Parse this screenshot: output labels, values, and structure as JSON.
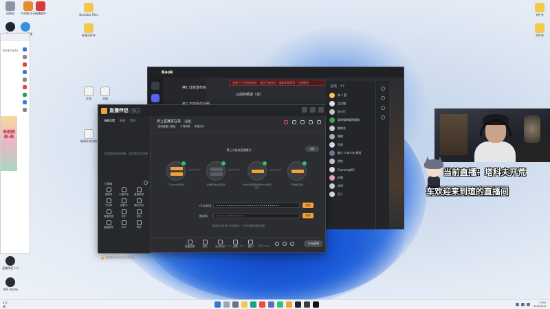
{
  "desktop": {
    "left_icons": [
      {
        "label": "回收站",
        "color": "#8a96a8"
      },
      {
        "label": "中文版-乐乐",
        "color": "#e98a2c"
      },
      {
        "label": "直播软件",
        "color": "#d93a3a"
      },
      {
        "label": "Steam",
        "color": "#1b2838"
      },
      {
        "label": "游戏加速器",
        "color": "#3a8ee0"
      }
    ],
    "folder_icons": [
      {
        "label": "Bandizip Files",
        "color": "#f2c94c"
      },
      {
        "label": "新建文件夹",
        "color": "#f2c94c"
      }
    ],
    "right_icons": [
      {
        "label": "文件夹",
        "color": "#f2c94c"
      },
      {
        "label": "文件夹",
        "color": "#f2c94c"
      }
    ],
    "bottom_icons": [
      {
        "label": "直播伴侣 1.0",
        "color": "#2a2d33"
      },
      {
        "label": "OBS Studio",
        "color": "#2a2d33"
      }
    ],
    "doc_icons": [
      {
        "label": "文档",
        "color": "#e8e8e8"
      },
      {
        "label": "文档",
        "color": "#e8e8e8"
      },
      {
        "label": "新建文本文档",
        "color": "#e8e8e8"
      }
    ]
  },
  "browser": {
    "tab_label": "Bookmarks",
    "banner_text": "来刷刷 画·画"
  },
  "chat_app": {
    "brand": "Kook",
    "room_title": "神1 日前发布完",
    "channel_title": "以前的频道（全）",
    "channel2": "第三方的事件问题",
    "alert": "频道个人消息被锁定 · 成员已被禁言 · 请联系管理员",
    "alert_btn": "立即解锁",
    "members_head": "在线 · 37",
    "members": [
      {
        "name": "神 1 狐",
        "color": "#f3c64a"
      },
      {
        "name": "吉吉猫",
        "color": "#e0e4ea"
      },
      {
        "name": "奶小叮",
        "color": "#c9c9c9"
      },
      {
        "name": "猫咪猫咪猫咪猫咪",
        "color": "#3fa45a"
      },
      {
        "name": "糖果花",
        "color": "#d0d4da"
      },
      {
        "name": "棉棉",
        "color": "#a7b2c0"
      },
      {
        "name": "豆皮",
        "color": "#dfe3e8"
      },
      {
        "name": "敏小 少年少年 想说",
        "color": "#6a7d94"
      },
      {
        "name": "快快",
        "color": "#c5cbd2"
      },
      {
        "name": "FlameingHD",
        "color": "#e5e5e5"
      },
      {
        "name": "好猫",
        "color": "#f0a7b4"
      },
      {
        "name": "炸鸡",
        "color": "#cdd2d9"
      },
      {
        "name": "无人",
        "color": "#d8dce2"
      }
    ]
  },
  "app": {
    "brand": "直播伴侣",
    "version": "PC ▾",
    "sidebar_tabs": [
      "场景设置",
      "直播",
      "素材"
    ],
    "empty_tip": "添加素材开始直播，添加素材至场景",
    "tools_label": "工具箱",
    "tools": [
      {
        "label": "直播间"
      },
      {
        "label": "主播学堂"
      },
      {
        "label": "直播数据"
      },
      {
        "label": "节目单"
      },
      {
        "label": "连麦PK"
      },
      {
        "label": "福利派送"
      },
      {
        "label": "直播设置"
      },
      {
        "label": "音乐"
      },
      {
        "label": "更多"
      },
      {
        "label": "直播推荐"
      },
      {
        "label": "OBS"
      },
      {
        "label": "帮助"
      }
    ],
    "hint": "观看直播间请关注主播直播",
    "room_name": "去上直播发在等",
    "room_tag": "直播",
    "sub_items": [
      "游戏直播 · 电脑",
      "开播提醒",
      "直播回放"
    ],
    "step_header": "第三方推流直播模式",
    "switch_btn": "切换",
    "steps": [
      {
        "label": "下载OBS推流软件"
      },
      {
        "label": "复制推流地址和密钥"
      },
      {
        "label": "将地址和密钥粘贴到OBS推流设置中"
      },
      {
        "label": "开始推流直播"
      }
    ],
    "rtmp_label": "rtmp地址",
    "rtmp_value": "••••••••••••••••••••••••••••••••",
    "key_label": "推流码",
    "key_value": "••••••••••••••",
    "copy_label": "复制",
    "note": "推流码仅适用于本场直播，下次开播需要重新获取",
    "bottom_items": [
      {
        "label": "直播设置"
      },
      {
        "label": "美颜"
      },
      {
        "label": "互动玩法"
      },
      {
        "label": "连麦"
      },
      {
        "label": "音乐"
      }
    ],
    "start_btn": "开始直播",
    "status": [
      "CPU 12%",
      "内存 45%",
      "帧率 60",
      "码率 0kbps"
    ]
  },
  "overlay": {
    "now_playing": "当前直播：塔科夫开荒",
    "welcome": "车欢迎来到瑄的直播间"
  },
  "taskbar": {
    "weather_temp": "4°C",
    "weather_desc": "晴",
    "apps": [
      {
        "name": "windows-start",
        "color": "#2a7ad6"
      },
      {
        "name": "search",
        "color": "#9aa4b2"
      },
      {
        "name": "task-view",
        "color": "#6b7280"
      },
      {
        "name": "file-explorer",
        "color": "#f2c94c"
      },
      {
        "name": "edge",
        "color": "#1e9e8a"
      },
      {
        "name": "chrome",
        "color": "#e94b3c"
      },
      {
        "name": "store",
        "color": "#5c6bc0"
      },
      {
        "name": "wechat",
        "color": "#2ec36a"
      },
      {
        "name": "streaming-app",
        "color": "#f2a23a"
      },
      {
        "name": "steam",
        "color": "#1b2838"
      },
      {
        "name": "kook",
        "color": "#3a3d43"
      },
      {
        "name": "obs",
        "color": "#111111"
      }
    ],
    "time": "17:59",
    "date": "2023/12/4"
  }
}
